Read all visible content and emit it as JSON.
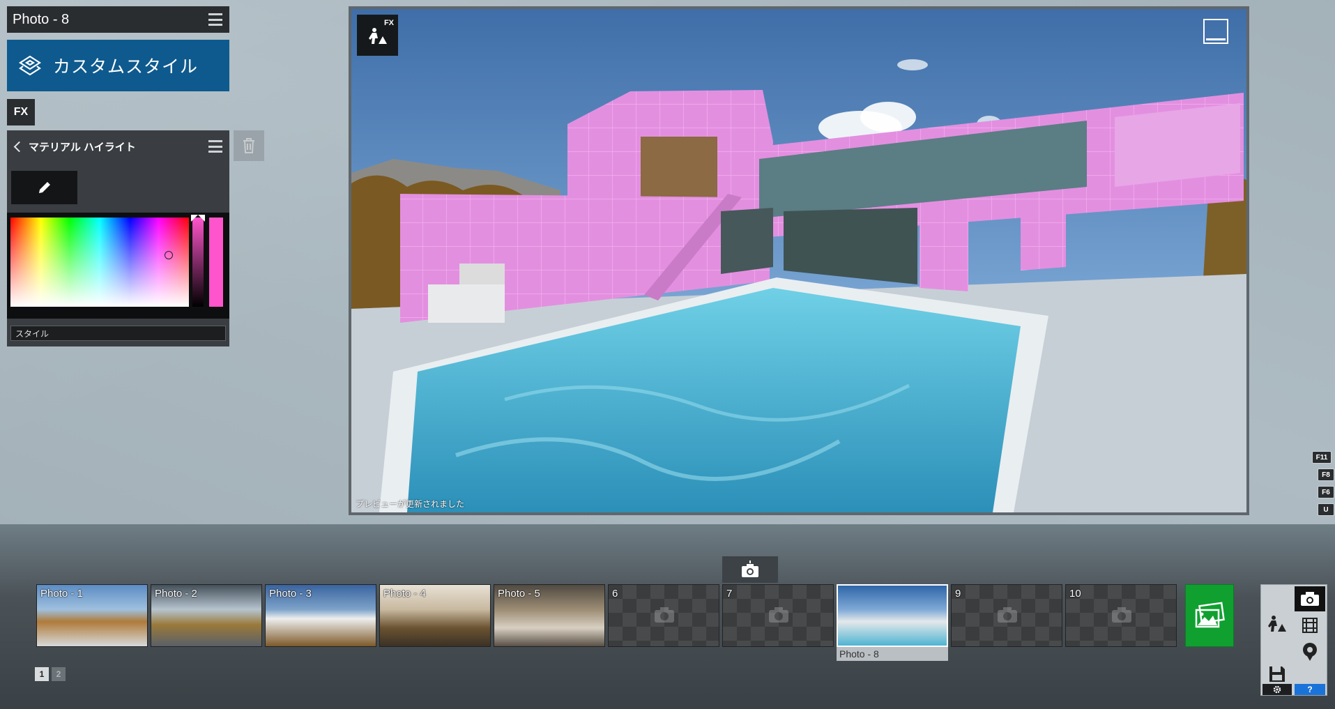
{
  "panel": {
    "photo_title": "Photo - 8",
    "style_name": "カスタムスタイル",
    "fx_label": "FX",
    "effect_title": "マテリアル ハイライト",
    "style_field_placeholder": "スタイル",
    "highlight_color": "#ff55cc"
  },
  "preview": {
    "fx_label": "FX",
    "status": "プレビューが更新されました"
  },
  "shortcuts": [
    "F11",
    "F8",
    "F6",
    "U"
  ],
  "filmstrip": {
    "thumbnails": [
      {
        "label": "Photo - 1",
        "filled": true
      },
      {
        "label": "Photo - 2",
        "filled": true
      },
      {
        "label": "Photo - 3",
        "filled": true
      },
      {
        "label": "Photo - 4",
        "filled": true
      },
      {
        "label": "Photo - 5",
        "filled": true
      },
      {
        "label": "6",
        "filled": false
      },
      {
        "label": "7",
        "filled": false
      },
      {
        "label": "",
        "filled": true,
        "selected": true
      },
      {
        "label": "9",
        "filled": false
      },
      {
        "label": "10",
        "filled": false
      }
    ],
    "selected_caption": "Photo - 8",
    "pages": [
      "1",
      "2"
    ],
    "current_page": "1"
  },
  "tools": {
    "help_label": "?"
  },
  "colors": {
    "brand_blue": "#0e5a8e",
    "gallery_green": "#10a030",
    "help_blue": "#1a73d9"
  }
}
